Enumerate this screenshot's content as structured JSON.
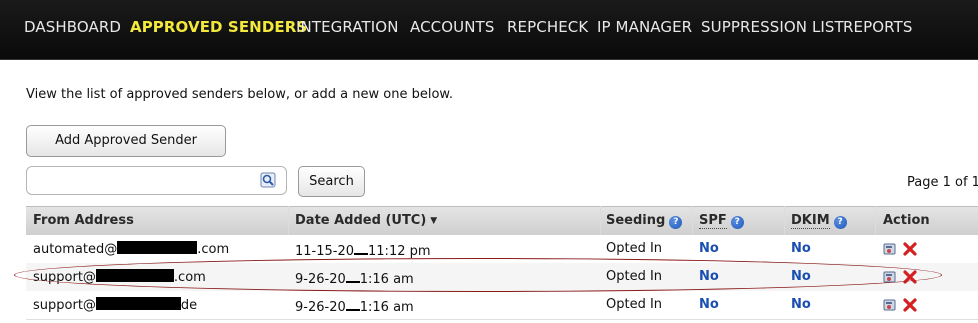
{
  "nav": {
    "items": [
      {
        "label": "DASHBOARD",
        "active": false
      },
      {
        "label": "APPROVED SENDERS",
        "active": true
      },
      {
        "label": "INTEGRATION",
        "active": false
      },
      {
        "label": "ACCOUNTS",
        "active": false
      },
      {
        "label": "REPCHECK",
        "active": false
      },
      {
        "label": "IP MANAGER",
        "active": false
      },
      {
        "label": "SUPPRESSION LIST",
        "active": false
      },
      {
        "label": "REPORTS",
        "active": false
      }
    ],
    "active_color": "#f3e93b"
  },
  "intro_text": "View the list of approved senders below, or add a new one below.",
  "add_button_label": "Add Approved Sender",
  "search": {
    "placeholder": "",
    "value": "",
    "button_label": "Search"
  },
  "pager_text": "Page 1 of 1",
  "table": {
    "headers": {
      "from": "From Address",
      "date": "Date Added (UTC)",
      "seeding": "Seeding",
      "spf": "SPF",
      "dkim": "DKIM",
      "action": "Action"
    },
    "rows": [
      {
        "from_prefix": "automated@",
        "from_suffix": ".com",
        "date_prefix": "11-15-20",
        "date_suffix": "11:12 pm",
        "seeding": "Opted In",
        "spf": "No",
        "dkim": "No"
      },
      {
        "from_prefix": "support@",
        "from_suffix": ".com",
        "date_prefix": "9-26-20",
        "date_suffix": "1:16 am",
        "seeding": "Opted In",
        "spf": "No",
        "dkim": "No"
      },
      {
        "from_prefix": "support@",
        "from_suffix": "de",
        "date_prefix": "9-26-20",
        "date_suffix": "1:16 am",
        "seeding": "Opted In",
        "spf": "No",
        "dkim": "No"
      }
    ]
  },
  "icons": {
    "search": "search-icon",
    "help": "help-icon",
    "edit": "edit-icon",
    "delete": "delete-icon"
  },
  "colors": {
    "link_blue": "#1a4fb0",
    "delete_red": "#d42020",
    "highlight_oval": "#8a1a1a"
  }
}
